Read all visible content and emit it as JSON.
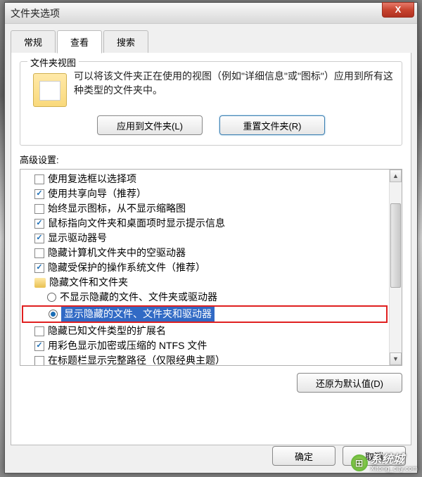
{
  "window": {
    "title": "文件夹选项",
    "close": "X"
  },
  "tabs": {
    "general": "常规",
    "view": "查看",
    "search": "搜索"
  },
  "folderView": {
    "legend": "文件夹视图",
    "desc": "可以将该文件夹正在使用的视图（例如\"详细信息\"或\"图标\"）应用到所有这种类型的文件夹中。",
    "apply": "应用到文件夹(L)",
    "reset": "重置文件夹(R)"
  },
  "advanced": {
    "label": "高级设置:",
    "items": [
      {
        "type": "chk",
        "checked": false,
        "text": "使用复选框以选择项",
        "indent": 1
      },
      {
        "type": "chk",
        "checked": true,
        "text": "使用共享向导（推荐）",
        "indent": 1
      },
      {
        "type": "chk",
        "checked": false,
        "text": "始终显示图标，从不显示缩略图",
        "indent": 1
      },
      {
        "type": "chk",
        "checked": true,
        "text": "鼠标指向文件夹和桌面项时显示提示信息",
        "indent": 1
      },
      {
        "type": "chk",
        "checked": true,
        "text": "显示驱动器号",
        "indent": 1
      },
      {
        "type": "chk",
        "checked": false,
        "text": "隐藏计算机文件夹中的空驱动器",
        "indent": 1
      },
      {
        "type": "chk",
        "checked": true,
        "text": "隐藏受保护的操作系统文件（推荐）",
        "indent": 1
      },
      {
        "type": "folder",
        "text": "隐藏文件和文件夹",
        "indent": 1
      },
      {
        "type": "radio",
        "checked": false,
        "text": "不显示隐藏的文件、文件夹或驱动器",
        "indent": 2
      },
      {
        "type": "radio",
        "checked": true,
        "text": "显示隐藏的文件、文件夹和驱动器",
        "indent": 2,
        "highlight": true,
        "selected": true
      },
      {
        "type": "chk",
        "checked": false,
        "text": "隐藏已知文件类型的扩展名",
        "indent": 1
      },
      {
        "type": "chk",
        "checked": true,
        "text": "用彩色显示加密或压缩的 NTFS 文件",
        "indent": 1
      },
      {
        "type": "chk",
        "checked": false,
        "text": "在标题栏显示完整路径（仅限经典主题）",
        "indent": 1
      }
    ],
    "restore": "还原为默认值(D)"
  },
  "buttons": {
    "ok": "确定",
    "cancel": "取消"
  },
  "watermark": {
    "main": "系统城",
    "sub": "Xitong_city.com"
  }
}
